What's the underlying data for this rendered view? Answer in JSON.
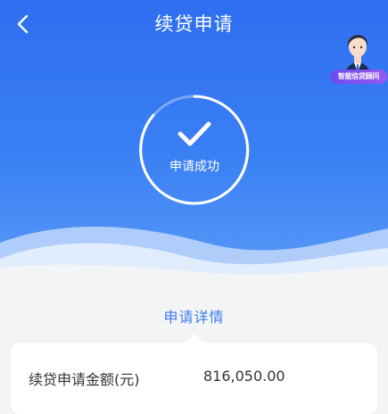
{
  "header": {
    "title": "续贷申请",
    "back_icon": "chevron-left-icon"
  },
  "advisor": {
    "label": "智能信贷顾问"
  },
  "status": {
    "icon": "checkmark-icon",
    "text": "申请成功"
  },
  "details": {
    "title": "申请详情",
    "rows": [
      {
        "label": "续贷申请金额(元)",
        "value": "816,050.00"
      }
    ]
  },
  "colors": {
    "primary": "#3a7bf0",
    "advisor_badge": "#7a50f1"
  }
}
